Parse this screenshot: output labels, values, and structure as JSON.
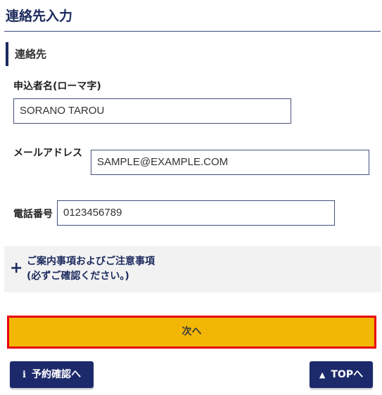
{
  "header": {
    "title": "連絡先入力"
  },
  "section": {
    "title": "連絡先"
  },
  "form": {
    "name": {
      "label": "申込者名(ローマ字)",
      "value": "SORANO TAROU"
    },
    "email": {
      "label": "メールアドレス",
      "value": "SAMPLE@EXAMPLE.COM"
    },
    "phone": {
      "label": "電話番号",
      "value": "0123456789"
    }
  },
  "notice": {
    "icon": "plus-icon",
    "line1": "ご案内事項およびご注意事項",
    "line2": "(必ずご確認ください。)"
  },
  "buttons": {
    "next_label": "次へ",
    "reservation_label": "予約確認へ",
    "reservation_icon": "info-icon",
    "top_label": "TOPへ",
    "top_icon": "home-icon"
  },
  "colors": {
    "navy": "#1c2a6b",
    "next_button_bg": "#f2b705",
    "next_button_border": "#e60012",
    "notice_bg": "#f2f2f2"
  }
}
